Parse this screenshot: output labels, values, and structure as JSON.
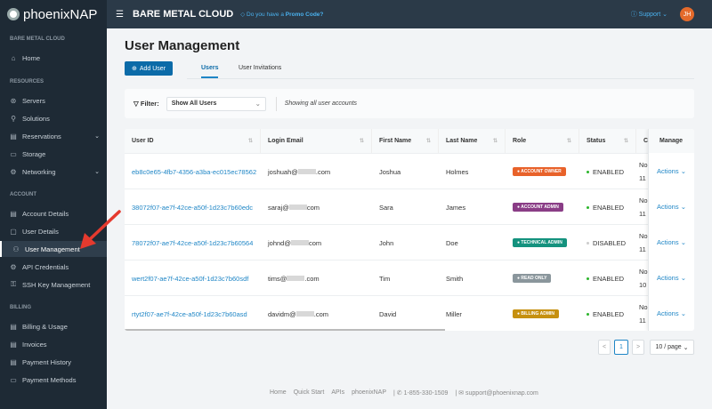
{
  "sidebar": {
    "logo": "phoenixNAP",
    "sections": [
      {
        "title": "BARE METAL CLOUD",
        "items": [
          {
            "label": "Home",
            "icon": "home-icon"
          }
        ]
      },
      {
        "title": "RESOURCES",
        "items": [
          {
            "label": "Servers",
            "icon": "servers-icon"
          },
          {
            "label": "Solutions",
            "icon": "solutions-icon"
          },
          {
            "label": "Reservations",
            "icon": "reservations-icon",
            "expand": true
          },
          {
            "label": "Storage",
            "icon": "storage-icon"
          },
          {
            "label": "Networking",
            "icon": "networking-icon",
            "expand": true
          }
        ]
      },
      {
        "title": "ACCOUNT",
        "items": [
          {
            "label": "Account Details",
            "icon": "account-icon"
          },
          {
            "label": "User Details",
            "icon": "user-icon"
          },
          {
            "label": "User Management",
            "icon": "users-icon",
            "active": true
          },
          {
            "label": "API Credentials",
            "icon": "api-icon"
          },
          {
            "label": "SSH Key Management",
            "icon": "key-icon"
          }
        ]
      },
      {
        "title": "BILLING",
        "items": [
          {
            "label": "Billing & Usage",
            "icon": "billing-icon"
          },
          {
            "label": "Invoices",
            "icon": "invoice-icon"
          },
          {
            "label": "Payment History",
            "icon": "history-icon"
          },
          {
            "label": "Payment Methods",
            "icon": "card-icon"
          }
        ]
      }
    ]
  },
  "header": {
    "brand": "BARE METAL CLOUD",
    "promo_prefix": "Do you have a ",
    "promo_link": "Promo Code?",
    "support": "Support",
    "avatar": "JH"
  },
  "page": {
    "title": "User Management",
    "add_user": "Add User",
    "tabs": [
      "Users",
      "User Invitations"
    ],
    "filter_label": "Filter:",
    "filter_value": "Show All Users",
    "filter_info": "Showing all user accounts"
  },
  "table": {
    "columns": [
      "User ID",
      "Login Email",
      "First Name",
      "Last Name",
      "Role",
      "Status",
      "Cr",
      "Manage"
    ],
    "rows": [
      {
        "id": "eb8c0e65-4fb7-4356-a3ba-ec015ec78562",
        "email_user": "joshuah@",
        "email_tld": ".com",
        "first": "Joshua",
        "last": "Holmes",
        "role": "ACCOUNT OWNER",
        "role_color": "#e8622a",
        "status": "ENABLED",
        "cr1": "No",
        "cr2": "11",
        "action": "Actions"
      },
      {
        "id": "38072f07-ae7f-42ce-a50f-1d23c7b60edc",
        "email_user": "saraj@",
        "email_tld": "com",
        "first": "Sara",
        "last": "James",
        "role": "ACCOUNT ADMIN",
        "role_color": "#8a3d86",
        "status": "ENABLED",
        "cr1": "No",
        "cr2": "11",
        "action": "Actions"
      },
      {
        "id": "78072f07-ae7f-42ce-a50f-1d23c7b60564",
        "email_user": "johnd@",
        "email_tld": "com",
        "first": "John",
        "last": "Doe",
        "role": "TECHNICAL ADMIN",
        "role_color": "#14927e",
        "status": "DISABLED",
        "cr1": "No",
        "cr2": "11",
        "action": "Actions"
      },
      {
        "id": "wert2f07-ae7f-42ce-a50f-1d23c7b60sdf",
        "email_user": "tims@",
        "email_tld": ".com",
        "first": "Tim",
        "last": "Smith",
        "role": "READ ONLY",
        "role_color": "#8a969c",
        "status": "ENABLED",
        "cr1": "No",
        "cr2": "10",
        "action": "Actions"
      },
      {
        "id": "rtyt2f07-ae7f-42ce-a50f-1d23c7b60asd",
        "email_user": "davidm@",
        "email_tld": ".com",
        "first": "David",
        "last": "Miller",
        "role": "BILLING ADMIN",
        "role_color": "#c6900f",
        "status": "ENABLED",
        "cr1": "No",
        "cr2": "11",
        "action": "Actions"
      }
    ]
  },
  "pagination": {
    "prev": "<",
    "current": "1",
    "next": ">",
    "page_size": "10 / page"
  },
  "footer": {
    "links": [
      "Home",
      "Quick Start",
      "APIs",
      "phoenixNAP"
    ],
    "phone": "1-855-330-1509",
    "email": "support@phoenixnap.com"
  },
  "colors": {
    "enabled": "#2cb52c",
    "disabled": "#cccccc",
    "accent": "#0c6ba8",
    "arrow": "#e53a2e"
  }
}
